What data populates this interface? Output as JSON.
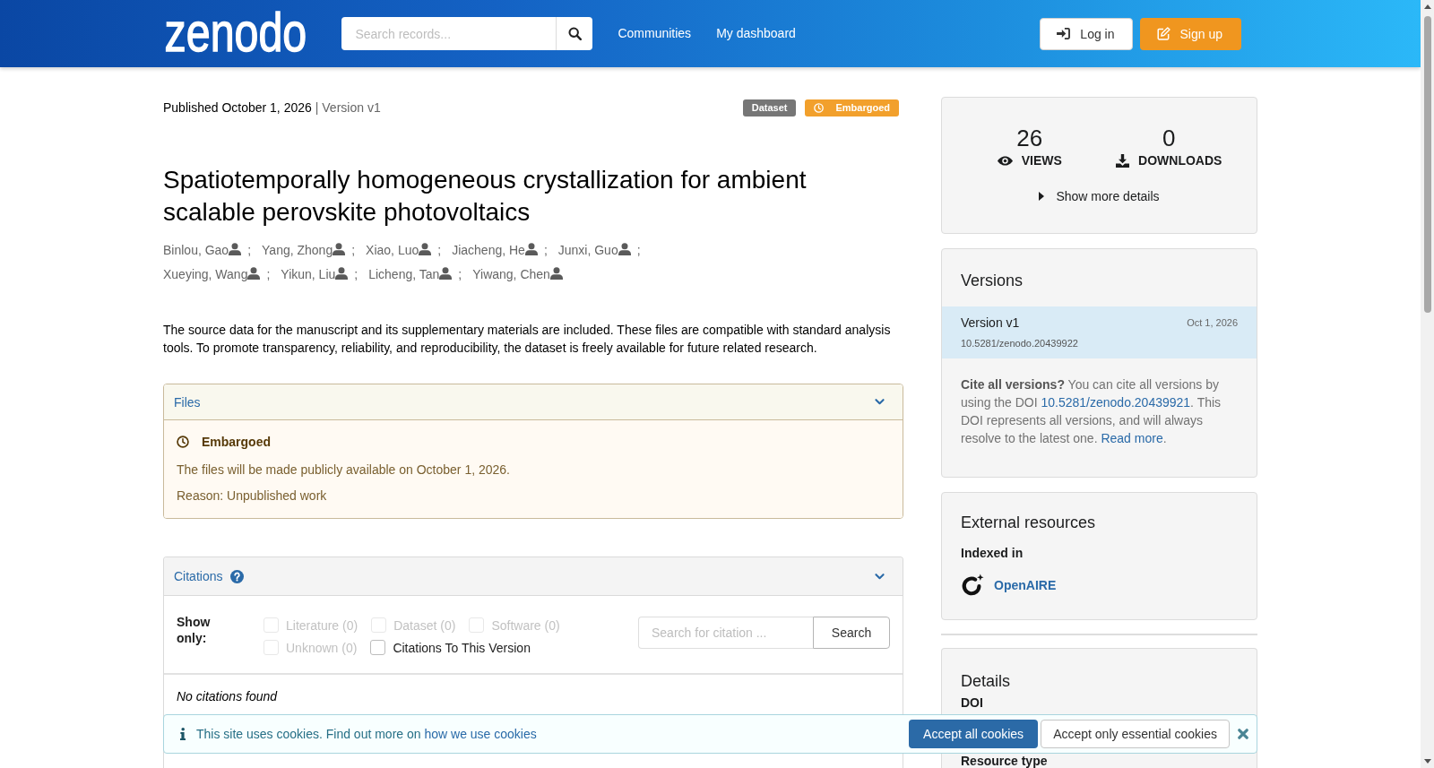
{
  "header": {
    "logo": "zenodo",
    "search": {
      "placeholder": "Search records..."
    },
    "nav": [
      {
        "label": "Communities"
      },
      {
        "label": "My dashboard"
      }
    ],
    "buttons": [
      {
        "label": "Log in",
        "kind": "login"
      },
      {
        "label": "Sign up",
        "kind": "signup"
      }
    ]
  },
  "record": {
    "published": "Published October 1, 2026",
    "version": "| Version v1",
    "badges": [
      {
        "label": "Dataset",
        "kind": "resource-type",
        "color": "#767676"
      },
      {
        "label": "Embargoed",
        "kind": "access",
        "color": "#f2a02c"
      }
    ],
    "title": "Spatiotemporally homogeneous crystallization for ambient scalable perovskite photovoltaics",
    "author_separator": ";",
    "authors": [
      "Binlou, Gao",
      "Yang, Zhong",
      "Xiao, Luo",
      "Jiacheng, He",
      "Junxi, Guo",
      "Xueying, Wang",
      "Yikun, Liu",
      "Licheng, Tan",
      "Yiwang, Chen"
    ],
    "description": "The source data for the manuscript and its supplementary materials are included. These files are compatible with standard analysis tools. To promote transparency, reliability, and reproducibility, the dataset is freely available for future related research."
  },
  "files": {
    "title": "Files",
    "expanded": true,
    "embargo": {
      "heading": "Embargoed",
      "message": "The files will be made publicly available on October 1, 2026.",
      "reason": "Reason: Unpublished work"
    }
  },
  "citations": {
    "title": "Citations",
    "expanded": true,
    "show_only_label": "Show only:",
    "filters": [
      {
        "label": "Literature (0)",
        "checked": false,
        "disabled": true
      },
      {
        "label": "Dataset (0)",
        "checked": false,
        "disabled": true
      },
      {
        "label": "Software (0)",
        "checked": false,
        "disabled": true
      },
      {
        "label": "Unknown (0)",
        "checked": false,
        "disabled": true
      },
      {
        "label": "Citations To This Version",
        "checked": false,
        "disabled": false
      }
    ],
    "search": {
      "placeholder": "Search for citation ...",
      "button": "Search"
    },
    "empty_message": "No citations found"
  },
  "sidebar": {
    "stats": {
      "items": [
        {
          "value": "26",
          "label": "VIEWS",
          "kind": "views"
        },
        {
          "value": "0",
          "label": "DOWNLOADS",
          "kind": "downloads"
        }
      ],
      "more_details": {
        "label": "Show more details",
        "expanded": false
      }
    },
    "versions": {
      "title": "Versions",
      "items": [
        {
          "label": "Version v1",
          "date": "Oct 1, 2026",
          "doi": "10.5281/zenodo.20439922",
          "selected": true
        }
      ],
      "cite_all": {
        "lead": "**Cite all versions?** You can cite all versions by using the DOI ",
        "doi_link": "10.5281/zenodo.20439921",
        "middle": ". This DOI represents all versions, and will always resolve to the latest one. ",
        "read_more": "Read more",
        "end": "."
      }
    },
    "external_resources": {
      "title": "External resources",
      "indexed_in_label": "Indexed in",
      "resources": [
        {
          "name": "OpenAIRE"
        }
      ]
    },
    "details": {
      "title": "Details",
      "fields": [
        {
          "label": "DOI"
        },
        {
          "label": "Resource type"
        }
      ]
    }
  },
  "cookie_banner": {
    "message": "This site uses cookies. Find out more on ",
    "link": "how we use cookies",
    "buttons": [
      {
        "label": "Accept all cookies",
        "kind": "primary"
      },
      {
        "label": "Accept only essential cookies",
        "kind": "secondary"
      }
    ]
  }
}
